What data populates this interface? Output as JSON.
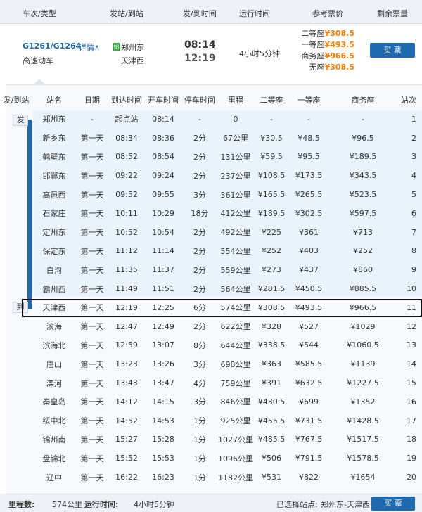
{
  "header": {
    "col_train": "车次/类型",
    "col_stations": "发站/到站",
    "col_times": "发/到时间",
    "col_duration": "运行时间",
    "col_price": "参考票价",
    "col_remaining": "剩余票量"
  },
  "train": {
    "number": "G1261/G1264",
    "detail": "详情∧",
    "type": "高速动车",
    "from_badge": "始",
    "from": "郑州东",
    "to": "天津西",
    "depart": "08:14",
    "arrive": "12:19",
    "duration": "4小时5分钟",
    "prices": [
      {
        "seat": "二等座",
        "price": "¥308.5"
      },
      {
        "seat": "一等座",
        "price": "¥493.5"
      },
      {
        "seat": "商务座",
        "price": "¥966.5"
      },
      {
        "seat": "无座",
        "price": "¥308.5"
      }
    ],
    "buy_label": "买 票"
  },
  "stops_header": [
    "发/到站",
    "站名",
    "日期",
    "到达时间",
    "开车时间",
    "停车时间",
    "里程",
    "二等座",
    "一等座",
    "商务座",
    "站次"
  ],
  "tags": {
    "depart": "发",
    "arrive": "到"
  },
  "stops": [
    [
      "郑州东",
      "-",
      "起点站",
      "08:14",
      "-",
      "0",
      "-",
      "-",
      "-",
      "1"
    ],
    [
      "新乡东",
      "第一天",
      "08:34",
      "08:36",
      "2分",
      "67公里",
      "¥30.5",
      "¥48.5",
      "¥96.5",
      "2"
    ],
    [
      "鹤壁东",
      "第一天",
      "08:52",
      "08:54",
      "2分",
      "131公里",
      "¥59.5",
      "¥95.5",
      "¥189.5",
      "3"
    ],
    [
      "邯郸东",
      "第一天",
      "09:22",
      "09:24",
      "2分",
      "237公里",
      "¥108.5",
      "¥173.5",
      "¥343.5",
      "4"
    ],
    [
      "高邑西",
      "第一天",
      "09:52",
      "09:55",
      "3分",
      "361公里",
      "¥165.5",
      "¥265.5",
      "¥523.5",
      "5"
    ],
    [
      "石家庄",
      "第一天",
      "10:11",
      "10:29",
      "18分",
      "412公里",
      "¥189.5",
      "¥302.5",
      "¥597.5",
      "6"
    ],
    [
      "定州东",
      "第一天",
      "10:52",
      "10:54",
      "2分",
      "492公里",
      "¥225",
      "¥361",
      "¥713",
      "7"
    ],
    [
      "保定东",
      "第一天",
      "11:12",
      "11:14",
      "2分",
      "554公里",
      "¥252",
      "¥403",
      "¥252",
      "8"
    ],
    [
      "白沟",
      "第一天",
      "11:35",
      "11:37",
      "2分",
      "559公里",
      "¥273",
      "¥437",
      "¥860",
      "9"
    ],
    [
      "霸州西",
      "第一天",
      "11:49",
      "11:51",
      "2分",
      "564公里",
      "¥281.5",
      "¥450.5",
      "¥885.5",
      "10"
    ],
    [
      "天津西",
      "第一天",
      "12:19",
      "12:25",
      "6分",
      "574公里",
      "¥308.5",
      "¥493.5",
      "¥966.5",
      "11"
    ],
    [
      "滨海",
      "第一天",
      "12:47",
      "12:49",
      "2分",
      "622公里",
      "¥328",
      "¥527",
      "¥1029",
      "12"
    ],
    [
      "滨海北",
      "第一天",
      "12:59",
      "13:07",
      "8分",
      "644公里",
      "¥338.5",
      "¥544",
      "¥1060.5",
      "13"
    ],
    [
      "唐山",
      "第一天",
      "13:23",
      "13:26",
      "3分",
      "698公里",
      "¥363",
      "¥585.5",
      "¥1139",
      "14"
    ],
    [
      "滦河",
      "第一天",
      "13:43",
      "13:47",
      "4分",
      "759公里",
      "¥391",
      "¥632.5",
      "¥1227.5",
      "15"
    ],
    [
      "秦皇岛",
      "第一天",
      "14:12",
      "14:15",
      "3分",
      "846公里",
      "¥430.5",
      "¥699",
      "¥1352",
      "16"
    ],
    [
      "绥中北",
      "第一天",
      "14:52",
      "14:53",
      "1分",
      "925公里",
      "¥455.5",
      "¥731.5",
      "¥1428.5",
      "17"
    ],
    [
      "锦州南",
      "第一天",
      "15:27",
      "15:28",
      "1分",
      "1027公里",
      "¥485.5",
      "¥767.5",
      "¥1517.5",
      "18"
    ],
    [
      "盘锦北",
      "第一天",
      "15:52",
      "15:53",
      "1分",
      "1096公里",
      "¥506",
      "¥791.5",
      "¥1578.5",
      "19"
    ],
    [
      "辽中",
      "第一天",
      "16:22",
      "16:23",
      "1分",
      "1182公里",
      "¥531",
      "¥822",
      "¥1654",
      "20"
    ]
  ],
  "footer": {
    "mileage_label": "里程数:",
    "mileage_value": "574公里",
    "runtime_label": "运行时间:",
    "runtime_value": "4小时5分钟",
    "selected_label": "已选择站点:",
    "selected_value": "郑州东-天津西",
    "buy_label": "买 票"
  },
  "colors": {
    "accent": "#1e6ab0",
    "price": "#ff7e00",
    "badge": "#39a548"
  }
}
